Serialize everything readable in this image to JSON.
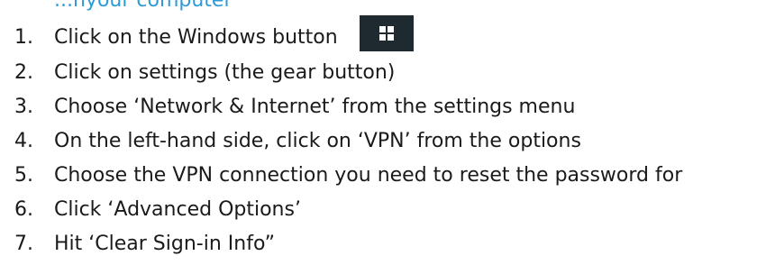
{
  "heading": "...nyour computer",
  "steps": [
    {
      "number": "1.",
      "text": "Click on the Windows button"
    },
    {
      "number": "2.",
      "text": "Click on settings (the gear button)"
    },
    {
      "number": "3.",
      "text": "Choose ‘Network & Internet’ from the settings menu"
    },
    {
      "number": "4.",
      "text": "On the left-hand side, click on ‘VPN’ from the options"
    },
    {
      "number": "5.",
      "text": "Choose the VPN connection you need to reset the password for"
    },
    {
      "number": "6.",
      "text": "Click ‘Advanced Options’"
    },
    {
      "number": "7.",
      "text": "Hit ‘Clear Sign-in Info”"
    }
  ],
  "icons": {
    "windows_button": "windows-logo-icon"
  },
  "colors": {
    "heading": "#2e9bd6",
    "windows_button_bg": "#1f2a30",
    "text": "#1a1a1a"
  }
}
